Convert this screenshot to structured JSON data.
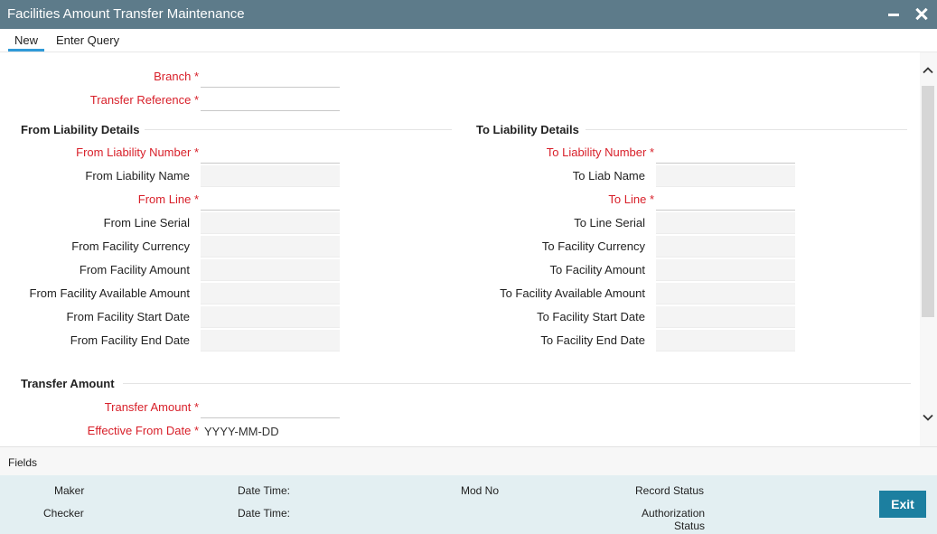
{
  "window": {
    "title": "Facilities Amount Transfer Maintenance"
  },
  "menu": {
    "new": "New",
    "enter_query": "Enter Query"
  },
  "header_fields": {
    "branch": {
      "label": "Branch",
      "value": ""
    },
    "transfer_reference": {
      "label": "Transfer Reference",
      "value": ""
    }
  },
  "from_section": {
    "title": "From Liability Details",
    "liability_number": {
      "label": "From Liability Number",
      "value": ""
    },
    "liability_name": {
      "label": "From Liability Name",
      "value": ""
    },
    "line": {
      "label": "From Line",
      "value": ""
    },
    "line_serial": {
      "label": "From Line Serial",
      "value": ""
    },
    "facility_currency": {
      "label": "From Facility Currency",
      "value": ""
    },
    "facility_amount": {
      "label": "From Facility Amount",
      "value": ""
    },
    "facility_available_amount": {
      "label": "From Facility Available Amount",
      "value": ""
    },
    "facility_start_date": {
      "label": "From Facility Start Date",
      "value": ""
    },
    "facility_end_date": {
      "label": "From Facility End Date",
      "value": ""
    }
  },
  "to_section": {
    "title": "To Liability Details",
    "liability_number": {
      "label": "To Liability Number",
      "value": ""
    },
    "liab_name": {
      "label": "To Liab Name",
      "value": ""
    },
    "line": {
      "label": "To Line",
      "value": ""
    },
    "line_serial": {
      "label": "To Line Serial",
      "value": ""
    },
    "facility_currency": {
      "label": "To Facility Currency",
      "value": ""
    },
    "facility_amount": {
      "label": "To Facility Amount",
      "value": ""
    },
    "facility_available_amount": {
      "label": "To Facility Available Amount",
      "value": ""
    },
    "facility_start_date": {
      "label": "To Facility Start Date",
      "value": ""
    },
    "facility_end_date": {
      "label": "To Facility End Date",
      "value": ""
    }
  },
  "transfer_section": {
    "title": "Transfer Amount",
    "transfer_amount": {
      "label": "Transfer Amount",
      "value": ""
    },
    "effective_from_date": {
      "label": "Effective From Date",
      "placeholder": "YYYY-MM-DD"
    }
  },
  "required_marker": "*",
  "fields_bar": {
    "label": "Fields"
  },
  "footer": {
    "maker": "Maker",
    "checker": "Checker",
    "date_time_1": "Date Time:",
    "date_time_2": "Date Time:",
    "mod_no": "Mod No",
    "record_status": "Record Status",
    "authorization_status_line1": "Authorization",
    "authorization_status_line2": "Status",
    "exit": "Exit"
  },
  "colors": {
    "titlebar": "#5d7b8a",
    "required_label": "#d8202a",
    "tab_underline": "#2f9ad8",
    "footer_bg": "#e3eff2",
    "exit_button": "#1c7fa0"
  }
}
